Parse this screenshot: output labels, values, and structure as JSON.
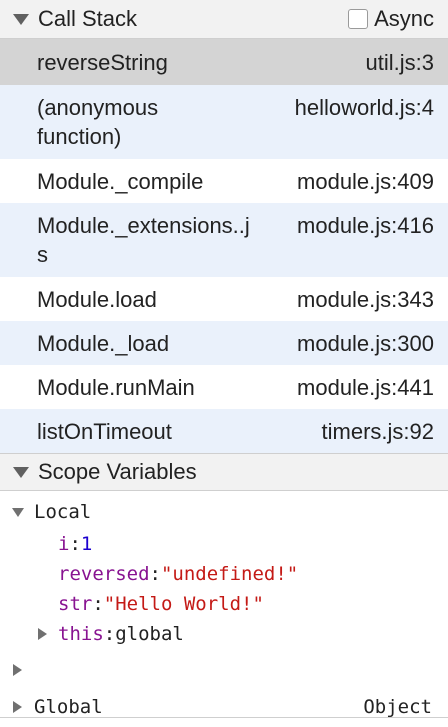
{
  "call_stack": {
    "title": "Call Stack",
    "async_label": "Async",
    "async_checked": false,
    "frames": [
      {
        "name": "reverseString",
        "location": "util.js:3"
      },
      {
        "name": "(anonymous function)",
        "location": "helloworld.js:4"
      },
      {
        "name": "Module._compile",
        "location": "module.js:409"
      },
      {
        "name": "Module._extensions..js",
        "location": "module.js:416"
      },
      {
        "name": "Module.load",
        "location": "module.js:343"
      },
      {
        "name": "Module._load",
        "location": "module.js:300"
      },
      {
        "name": "Module.runMain",
        "location": "module.js:441"
      },
      {
        "name": "listOnTimeout",
        "location": "timers.js:92"
      }
    ]
  },
  "scope": {
    "title": "Scope Variables",
    "local_label": "Local",
    "vars": [
      {
        "key": "i",
        "sep": ": ",
        "value": "1"
      },
      {
        "key": "reversed",
        "sep": ": ",
        "value": "\"undefined!\""
      },
      {
        "key": "str",
        "sep": ": ",
        "value": "\"Hello World!\""
      },
      {
        "key": "this",
        "sep": ": ",
        "value": "global"
      }
    ],
    "global_label": "Global",
    "global_value": "Object"
  }
}
